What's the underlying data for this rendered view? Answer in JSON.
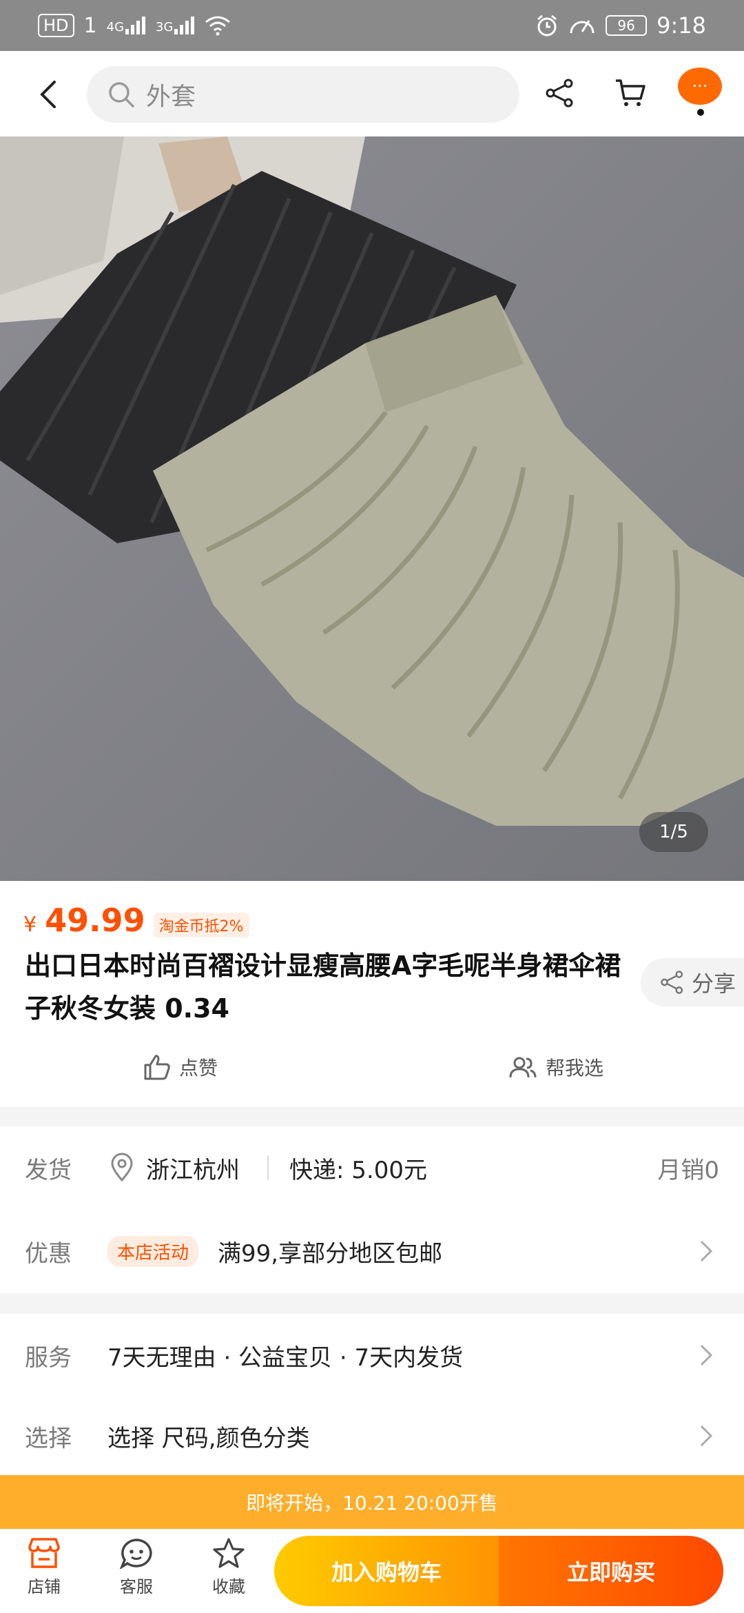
{
  "status_bar": {
    "hd": "HD",
    "sim1": "1",
    "net1": "4G",
    "net2": "3G",
    "battery": "96",
    "time": "9:18"
  },
  "nav": {
    "search_placeholder": "外套",
    "more_label": "···"
  },
  "gallery": {
    "counter": "1/5"
  },
  "product": {
    "currency": "¥",
    "price": "49.99",
    "coin_tag": "淘金币抵2%",
    "title": "出口日本时尚百褶设计显瘦高腰A字毛呢半身裙伞裙子秋冬女装 0.34",
    "share_label": "分享",
    "like_label": "点赞",
    "help_choose_label": "帮我选"
  },
  "shipping": {
    "label": "发货",
    "location": "浙江杭州",
    "express": "快递: 5.00元",
    "monthly_sales": "月销0"
  },
  "promo": {
    "label": "优惠",
    "tag": "本店活动",
    "text": "满99,享部分地区包邮"
  },
  "service": {
    "label": "服务",
    "text": "7天无理由 · 公益宝贝 · 7天内发货"
  },
  "select": {
    "label": "选择",
    "text": "选择 尺码,颜色分类"
  },
  "banner": {
    "text": "即将开始，10.21 20:00开售"
  },
  "bottom_bar": {
    "shop": "店铺",
    "service": "客服",
    "favorite": "收藏",
    "add_cart": "加入购物车",
    "buy_now": "立即购买"
  },
  "colors": {
    "accent": "#ff5000",
    "cart_gradient": "#ffcb00",
    "buy_gradient": "#ff4900",
    "banner": "#ffae2b"
  }
}
